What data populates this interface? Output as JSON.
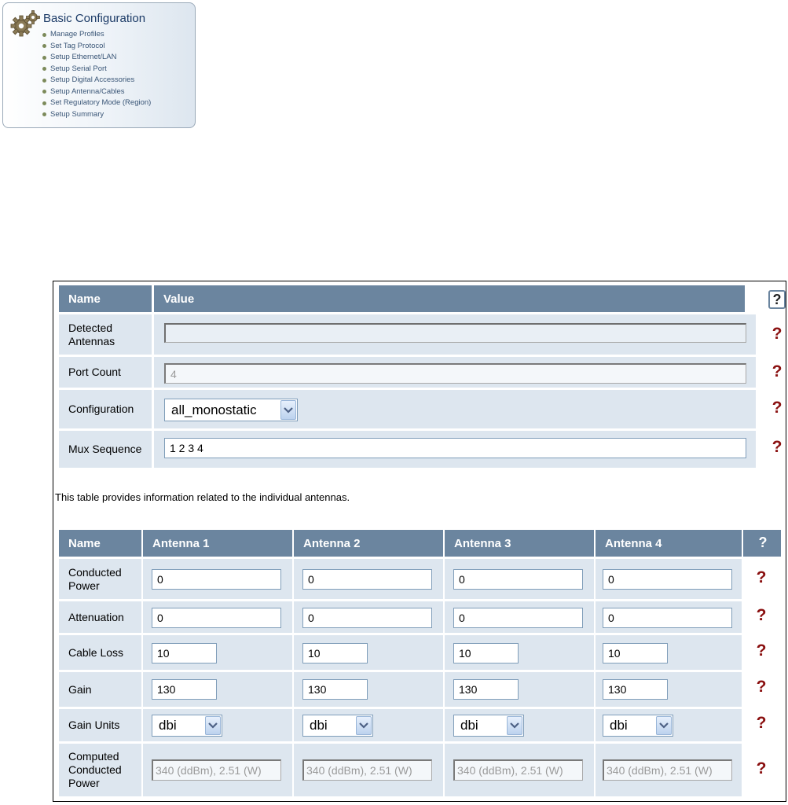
{
  "nav": {
    "title": "Basic Configuration",
    "items": [
      "Manage Profiles",
      "Set Tag Protocol",
      "Setup Ethernet/LAN",
      "Setup Serial Port",
      "Setup Digital Accessories",
      "Setup Antenna/Cables",
      "Set Regulatory Mode (Region)",
      "Setup Summary"
    ]
  },
  "table1": {
    "headers": {
      "name": "Name",
      "value": "Value",
      "help": "?"
    },
    "rows": {
      "detected": {
        "label": "Detected Antennas",
        "value": ""
      },
      "port_count": {
        "label": "Port Count",
        "value": "4"
      },
      "configuration": {
        "label": "Configuration",
        "value": "all_monostatic"
      },
      "mux": {
        "label": "Mux Sequence",
        "value": "1 2 3 4"
      }
    },
    "help_mark": "?"
  },
  "description": "This table provides information related to the individual antennas.",
  "table2": {
    "headers": {
      "name": "Name",
      "a1": "Antenna 1",
      "a2": "Antenna 2",
      "a3": "Antenna 3",
      "a4": "Antenna 4",
      "help": "?"
    },
    "rows": {
      "conducted_power": {
        "label": "Conducted Power",
        "values": [
          "0",
          "0",
          "0",
          "0"
        ]
      },
      "attenuation": {
        "label": "Attenuation",
        "values": [
          "0",
          "0",
          "0",
          "0"
        ]
      },
      "cable_loss": {
        "label": "Cable Loss",
        "values": [
          "10",
          "10",
          "10",
          "10"
        ]
      },
      "gain": {
        "label": "Gain",
        "values": [
          "130",
          "130",
          "130",
          "130"
        ]
      },
      "gain_units": {
        "label": "Gain Units",
        "values": [
          "dbi",
          "dbi",
          "dbi",
          "dbi"
        ]
      },
      "computed": {
        "label": "Computed Conducted Power",
        "values": [
          "340 (ddBm), 2.51 (W)",
          "340 (ddBm), 2.51 (W)",
          "340 (ddBm), 2.51 (W)",
          "340 (ddBm), 2.51 (W)"
        ]
      }
    },
    "help_mark": "?"
  },
  "colors": {
    "header": "#6b859f",
    "cell": "#dde6ef",
    "help_mark": "#8a1010"
  }
}
